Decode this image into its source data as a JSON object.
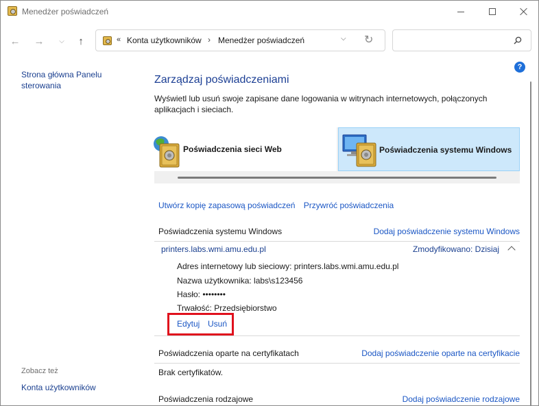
{
  "window": {
    "title": "Menedżer poświadczeń"
  },
  "addressbar": {
    "prefix": "«",
    "crumbs": [
      "Konta użytkowników",
      "Menedżer poświadczeń"
    ],
    "separator": "›"
  },
  "search": {
    "placeholder": ""
  },
  "sidebar": {
    "home": "Strona główna Panelu sterowania",
    "see_also": "Zobacz też",
    "accounts": "Konta użytkowników"
  },
  "main": {
    "title": "Zarządzaj poświadczeniami",
    "description": "Wyświetl lub usuń swoje zapisane dane logowania w witrynach internetowych, połączonych aplikacjach i sieciach.",
    "tabs": [
      {
        "label": "Poświadczenia sieci Web",
        "selected": false
      },
      {
        "label": "Poświadczenia systemu Windows",
        "selected": true
      }
    ],
    "backup_link": "Utwórz kopię zapasową poświadczeń",
    "restore_link": "Przywróć poświadczenia"
  },
  "windows_section": {
    "title": "Poświadczenia systemu Windows",
    "add": "Dodaj poświadczenie systemu Windows",
    "credential": {
      "name": "printers.labs.wmi.amu.edu.pl",
      "modified": "Zmodyfikowano:  Dzisiaj",
      "address": "Adres internetowy lub sieciowy:  printers.labs.wmi.amu.edu.pl",
      "username": "Nazwa użytkownika:  labs\\s123456",
      "password": "Hasło:  ••••••••",
      "persistence": "Trwałość:  Przedsiębiorstwo",
      "edit": "Edytuj",
      "remove": "Usuń"
    }
  },
  "cert_section": {
    "title": "Poświadczenia oparte na certyfikatach",
    "add": "Dodaj poświadczenie oparte na certyfikacie",
    "empty": "Brak certyfikatów."
  },
  "generic_section": {
    "title": "Poświadczenia rodzajowe",
    "add": "Dodaj poświadczenie rodzajowe"
  },
  "colors": {
    "link": "#1a56c4",
    "title": "#1c3f94",
    "tab_selected": "#cde8fb",
    "highlight": "#e0101c",
    "help": "#1e6fd9"
  },
  "icons": {
    "app": "credential-vault-icon",
    "help": "help-icon",
    "search": "search-icon"
  }
}
